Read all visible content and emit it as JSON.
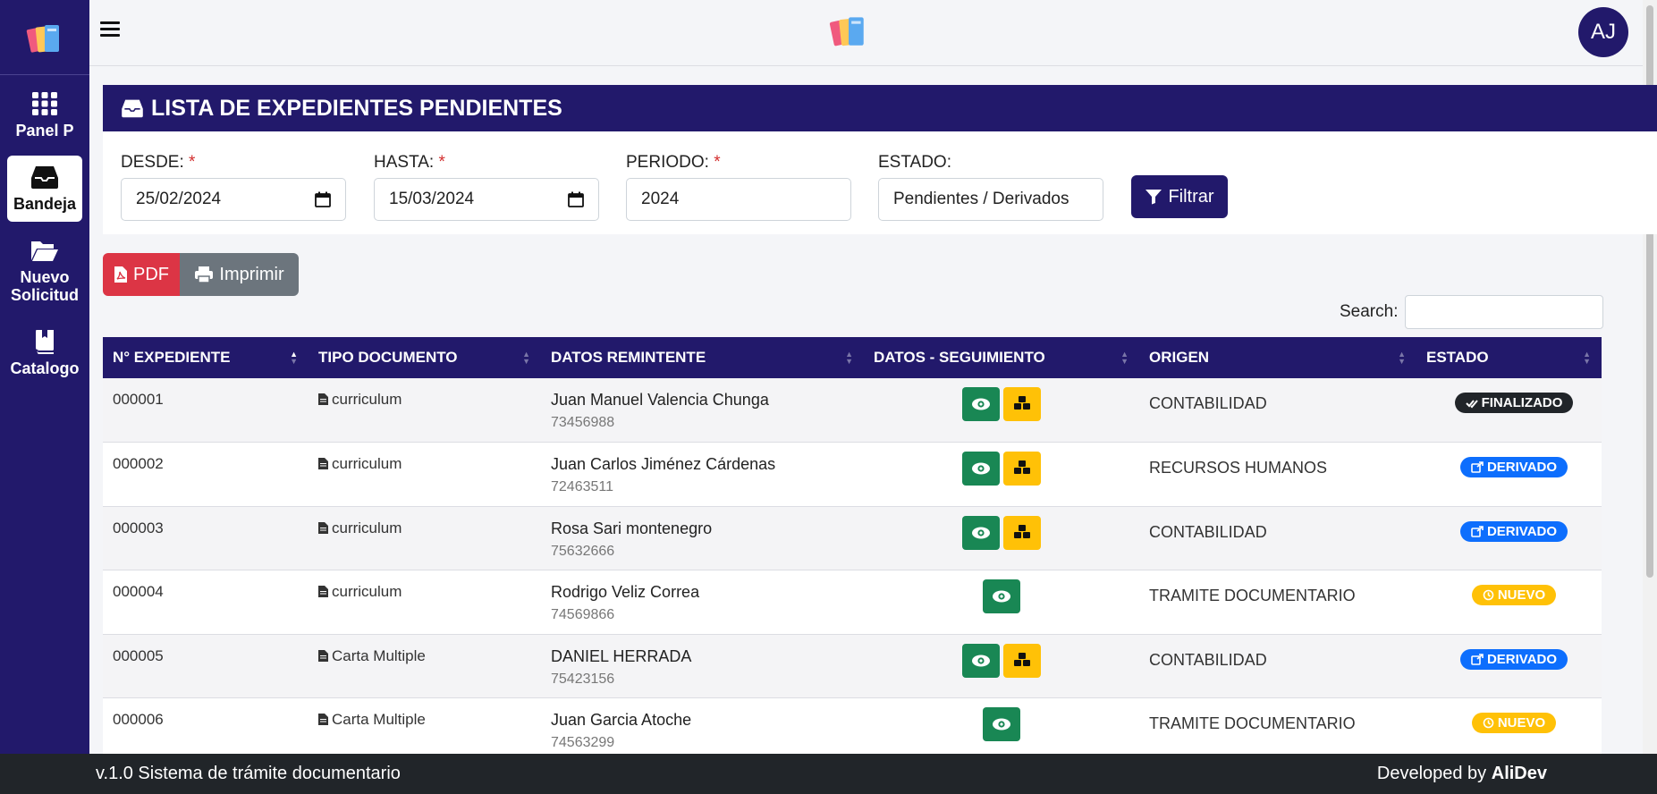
{
  "sidebar": {
    "items": [
      {
        "label": "Panel P",
        "icon": "grid-icon"
      },
      {
        "label": "Bandeja",
        "icon": "inbox-icon",
        "active": true
      },
      {
        "label": "Nuevo Solicitud",
        "icon": "folder-open-icon"
      },
      {
        "label": "Catalogo",
        "icon": "book-icon"
      }
    ]
  },
  "header": {
    "avatar_initials": "AJ"
  },
  "panel": {
    "title": "LISTA DE EXPEDIENTES PENDIENTES"
  },
  "filters": {
    "desde": {
      "label": "DESDE:",
      "required": "*",
      "value": "25/02/2024"
    },
    "hasta": {
      "label": "HASTA:",
      "required": "*",
      "value": "15/03/2024"
    },
    "periodo": {
      "label": "PERIODO:",
      "required": "*",
      "value": "2024"
    },
    "estado": {
      "label": "ESTADO:",
      "value": "Pendientes / Derivados"
    },
    "button_label": "Filtrar"
  },
  "actions": {
    "pdf_label": "PDF",
    "print_label": "Imprimir"
  },
  "search": {
    "label": "Search:",
    "value": ""
  },
  "table": {
    "columns": [
      "N° EXPEDIENTE",
      "TIPO DOCUMENTO",
      "DATOS REMINTENTE",
      "DATOS - SEGUIMIENTO",
      "ORIGEN",
      "ESTADO"
    ],
    "rows": [
      {
        "num": "000001",
        "tipo": "curriculum",
        "nombre": "Juan Manuel Valencia Chunga",
        "dni": "73456988",
        "track": true,
        "origen": "CONTABILIDAD",
        "estado": "FINALIZADO",
        "estado_type": "fin"
      },
      {
        "num": "000002",
        "tipo": "curriculum",
        "nombre": "Juan Carlos Jiménez Cárdenas",
        "dni": "72463511",
        "track": true,
        "origen": "RECURSOS HUMANOS",
        "estado": "DERIVADO",
        "estado_type": "der"
      },
      {
        "num": "000003",
        "tipo": "curriculum",
        "nombre": "Rosa Sari montenegro",
        "dni": "75632666",
        "track": true,
        "origen": "CONTABILIDAD",
        "estado": "DERIVADO",
        "estado_type": "der"
      },
      {
        "num": "000004",
        "tipo": "curriculum",
        "nombre": "Rodrigo Veliz Correa",
        "dni": "74569866",
        "track": false,
        "origen": "TRAMITE DOCUMENTARIO",
        "estado": "NUEVO",
        "estado_type": "nue"
      },
      {
        "num": "000005",
        "tipo": "Carta Multiple",
        "nombre": "DANIEL HERRADA",
        "dni": "75423156",
        "track": true,
        "origen": "CONTABILIDAD",
        "estado": "DERIVADO",
        "estado_type": "der"
      },
      {
        "num": "000006",
        "tipo": "Carta Multiple",
        "nombre": "Juan Garcia Atoche",
        "dni": "74563299",
        "track": false,
        "origen": "TRAMITE DOCUMENTARIO",
        "estado": "NUEVO",
        "estado_type": "nue"
      }
    ]
  },
  "footer": {
    "left": "v.1.0 Sistema de trámite documentario",
    "right_prefix": "Developed by",
    "right_brand": "AliDev"
  },
  "colors": {
    "primary": "#22196b",
    "danger": "#dc3545",
    "secondary": "#6c757d",
    "success": "#198754",
    "warning": "#ffc107",
    "info": "#0d6efd",
    "dark": "#212529"
  }
}
